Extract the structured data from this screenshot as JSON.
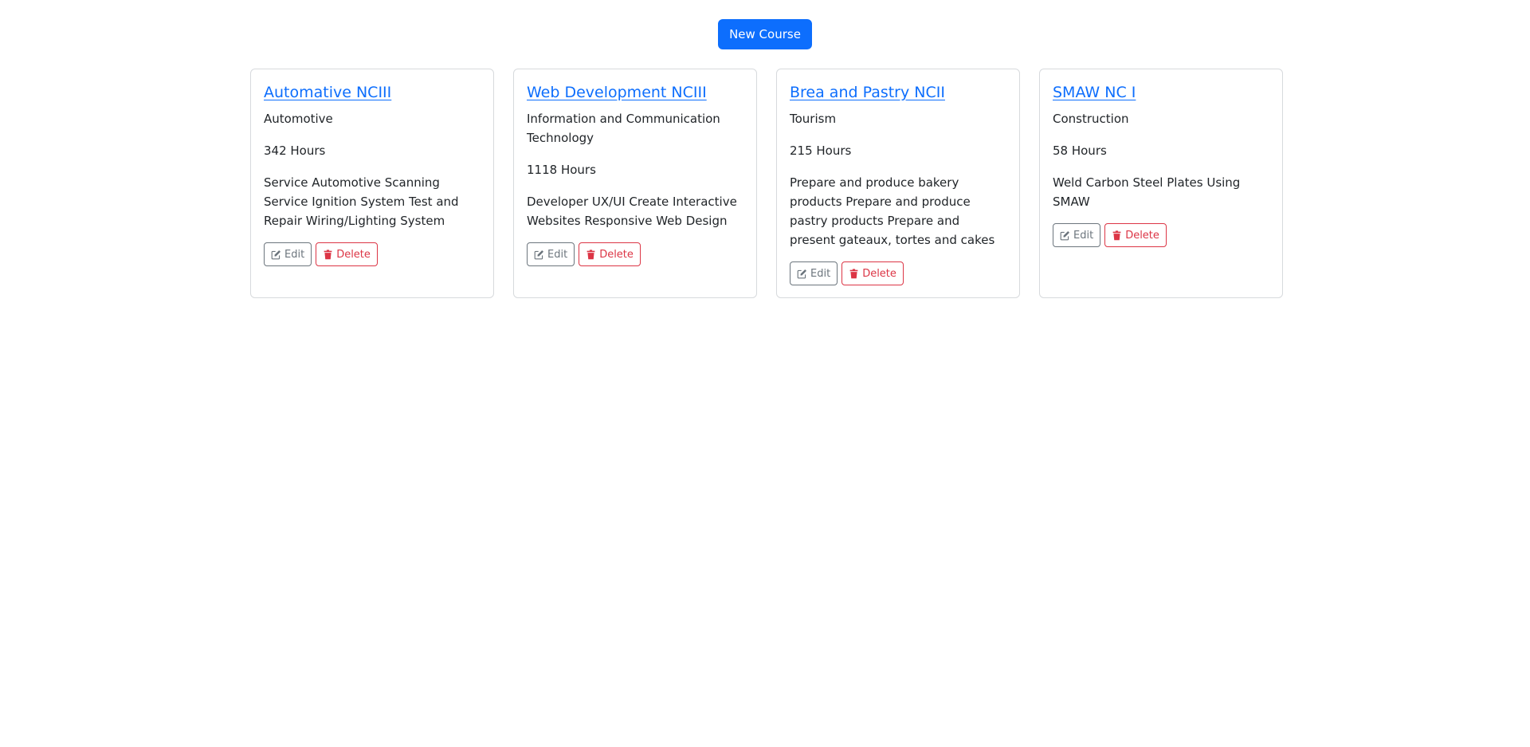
{
  "toolbar": {
    "new_course_label": "New Course"
  },
  "colors": {
    "primary": "#0d6efd",
    "secondary": "#6c757d",
    "danger": "#dc3545",
    "border": "#d7dadd"
  },
  "icons": {
    "edit": "edit-icon",
    "delete": "trash-icon"
  },
  "courses": [
    {
      "title": "Automative NCIII",
      "sector": "Automotive",
      "hours": "342 Hours",
      "description": "Service Automotive Scanning Service Ignition System Test and Repair Wiring/Lighting System",
      "edit_label": "Edit",
      "delete_label": "Delete"
    },
    {
      "title": "Web Development NCIII",
      "sector": "Information and Communication Technology",
      "hours": "1118 Hours",
      "description": "Developer UX/UI Create Interactive Websites Responsive Web Design",
      "edit_label": "Edit",
      "delete_label": "Delete"
    },
    {
      "title": "Brea and Pastry NCII",
      "sector": "Tourism",
      "hours": "215 Hours",
      "description": "Prepare and produce bakery products Prepare and produce pastry products Prepare and present gateaux, tortes and cakes",
      "edit_label": "Edit",
      "delete_label": "Delete"
    },
    {
      "title": "SMAW NC I",
      "sector": "Construction",
      "hours": "58 Hours",
      "description": "Weld Carbon Steel Plates Using SMAW",
      "edit_label": "Edit",
      "delete_label": "Delete"
    }
  ]
}
